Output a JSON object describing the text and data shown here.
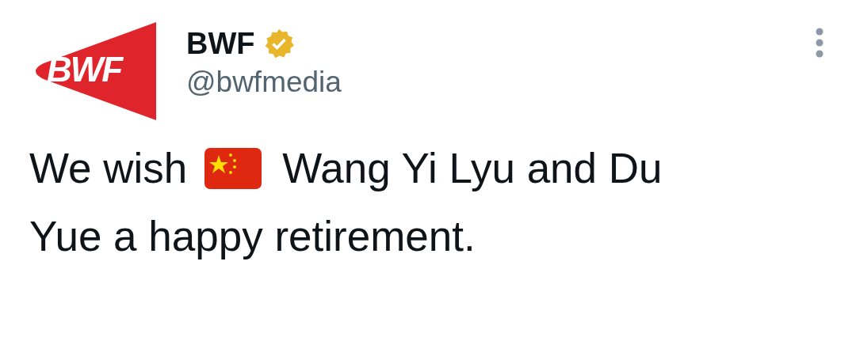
{
  "author": {
    "logo_text": "BWF",
    "name": "BWF",
    "verified": true,
    "handle": "@bwfmedia"
  },
  "tweet": {
    "text_before_flag": "We wish",
    "text_after_flag_line_1": "Wang Yi Lyu and Du",
    "text_line_2": "Yue a happy retirement."
  }
}
